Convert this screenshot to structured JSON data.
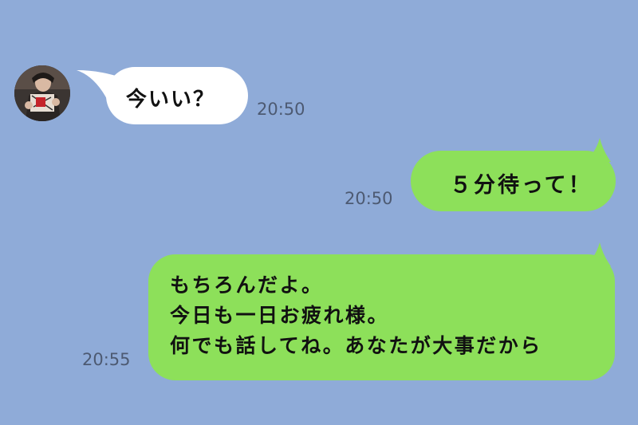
{
  "colors": {
    "background": "#8fabd8",
    "incoming_bubble": "#ffffff",
    "outgoing_bubble": "#8de05a",
    "timestamp": "#4d5a72"
  },
  "messages": [
    {
      "direction": "incoming",
      "has_avatar": true,
      "lines": [
        "今いい？"
      ],
      "time": "20:50"
    },
    {
      "direction": "outgoing",
      "lines": [
        "５分待って！"
      ],
      "time": "20:50"
    },
    {
      "direction": "outgoing",
      "lines": [
        "もちろんだよ。",
        "今日も一日お疲れ様。",
        "何でも話してね。あなたが大事だから"
      ],
      "time": "20:55"
    }
  ]
}
